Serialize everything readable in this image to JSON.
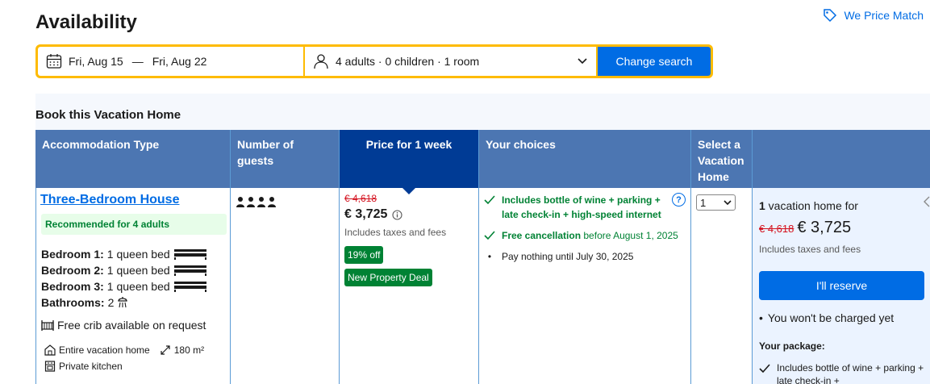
{
  "page": {
    "title": "Availability",
    "price_match": "We Price Match"
  },
  "search": {
    "checkin": "Fri, Aug 15",
    "separator": "—",
    "checkout": "Fri, Aug 22",
    "guests": "4 adults · 0 children · 1 room",
    "button": "Change search"
  },
  "section": {
    "title": "Book this Vacation Home"
  },
  "table": {
    "headers": {
      "accommodation": "Accommodation Type",
      "guests": "Number of guests",
      "price": "Price for 1 week",
      "choices": "Your choices",
      "select": "Select a Vacation Home"
    }
  },
  "room": {
    "name": "Three-Bedroom House",
    "recommended": "Recommended for 4 adults",
    "bed1_label": "Bedroom 1:",
    "bed1_value": "1 queen bed",
    "bed2_label": "Bedroom 2:",
    "bed2_value": "1 queen bed",
    "bed3_label": "Bedroom 3:",
    "bed3_value": "1 queen bed",
    "bath_label": "Bathrooms:",
    "bath_value": "2",
    "crib": "Free crib available on request",
    "entire": "Entire vacation home",
    "size": "180 m²",
    "kitchen": "Private kitchen"
  },
  "price": {
    "old": "€ 4,618",
    "new": "€ 3,725",
    "taxes": "Includes taxes and fees",
    "discount": "19% off",
    "deal": "New Property Deal"
  },
  "choices": {
    "c1": "Includes bottle of wine + parking + late check-in + high-speed internet",
    "c2_bold": "Free cancellation",
    "c2_rest": " before August 1, 2025",
    "c3": "Pay nothing until July 30, 2025",
    "help": "?"
  },
  "select": {
    "value": "1"
  },
  "reserve": {
    "count": "1",
    "title_rest": " vacation home for",
    "old": "€ 4,618",
    "new": "€ 3,725",
    "taxes": "Includes taxes and fees",
    "button": "I'll reserve",
    "note": "You won't be charged yet",
    "package_title": "Your package:",
    "package_item": "Includes bottle of wine + parking + late check-in +"
  },
  "colors": {
    "accent": "#006ce4",
    "header_bg": "#4c76b2",
    "header_highlight": "#003b95",
    "green": "#008234",
    "red": "#d4111e",
    "search_border": "#febb02"
  }
}
